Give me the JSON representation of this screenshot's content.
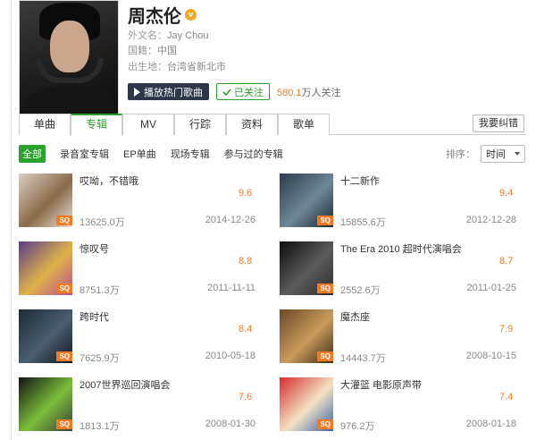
{
  "artist": {
    "name": "周杰伦",
    "verified_mark": "v",
    "foreign_name_label": "外文名：",
    "foreign_name": "Jay Chou",
    "nationality_label": "国籍：",
    "nationality": "中国",
    "birthplace_label": "出生地：",
    "birthplace": "台湾省新北市"
  },
  "actions": {
    "play_label": "播放热门歌曲",
    "follow_label": "已关注",
    "followers_count": "580.1",
    "followers_suffix": "万人关注"
  },
  "tabs": [
    {
      "label": "单曲",
      "active": false
    },
    {
      "label": "专辑",
      "active": true
    },
    {
      "label": "MV",
      "active": false
    },
    {
      "label": "行踪",
      "active": false
    },
    {
      "label": "资料",
      "active": false
    },
    {
      "label": "歌单",
      "active": false
    }
  ],
  "report_label": "我要纠错",
  "filters": {
    "items": [
      "全部",
      "录音室专辑",
      "EP单曲",
      "现场专辑",
      "参与过的专辑"
    ],
    "active_index": 0
  },
  "sort": {
    "label": "排序：",
    "selected": "时间"
  },
  "quality_badge": "SQ",
  "albums": [
    {
      "title": "哎呦，不错哦",
      "score": "9.6",
      "plays": "13625.0万",
      "date": "2014-12-26",
      "cover": [
        "#d8cfc2",
        "#8a6a4a",
        "#e9e2d8"
      ]
    },
    {
      "title": "十二新作",
      "score": "9.4",
      "plays": "15855.6万",
      "date": "2012-12-28",
      "cover": [
        "#2d3c4a",
        "#6f8796",
        "#1a2430"
      ]
    },
    {
      "title": "惊叹号",
      "score": "8.8",
      "plays": "8751.3万",
      "date": "2011-11-11",
      "cover": [
        "#5a3c8a",
        "#e0b34a",
        "#b54d8e"
      ]
    },
    {
      "title": "The Era 2010 超时代演唱会",
      "score": "8.7",
      "plays": "2552.6万",
      "date": "2011-01-25",
      "cover": [
        "#0e0e0e",
        "#5b5b5b",
        "#2c2c2c"
      ]
    },
    {
      "title": "跨时代",
      "score": "8.4",
      "plays": "7625.9万",
      "date": "2010-05-18",
      "cover": [
        "#1e2a36",
        "#4a5e70",
        "#0f161d"
      ]
    },
    {
      "title": "魔杰座",
      "score": "7.9",
      "plays": "14443.7万",
      "date": "2008-10-15",
      "cover": [
        "#6b4a28",
        "#c99a5a",
        "#3a2a18"
      ]
    },
    {
      "title": "2007世界巡回演唱会",
      "score": "7.6",
      "plays": "1813.1万",
      "date": "2008-01-30",
      "cover": [
        "#121212",
        "#7bbf3a",
        "#3a3a3a"
      ]
    },
    {
      "title": "大灌篮 电影原声带",
      "score": "7.4",
      "plays": "976.2万",
      "date": "2008-01-18",
      "cover": [
        "#d62c2c",
        "#f2e3c4",
        "#3a5fa8"
      ]
    }
  ]
}
